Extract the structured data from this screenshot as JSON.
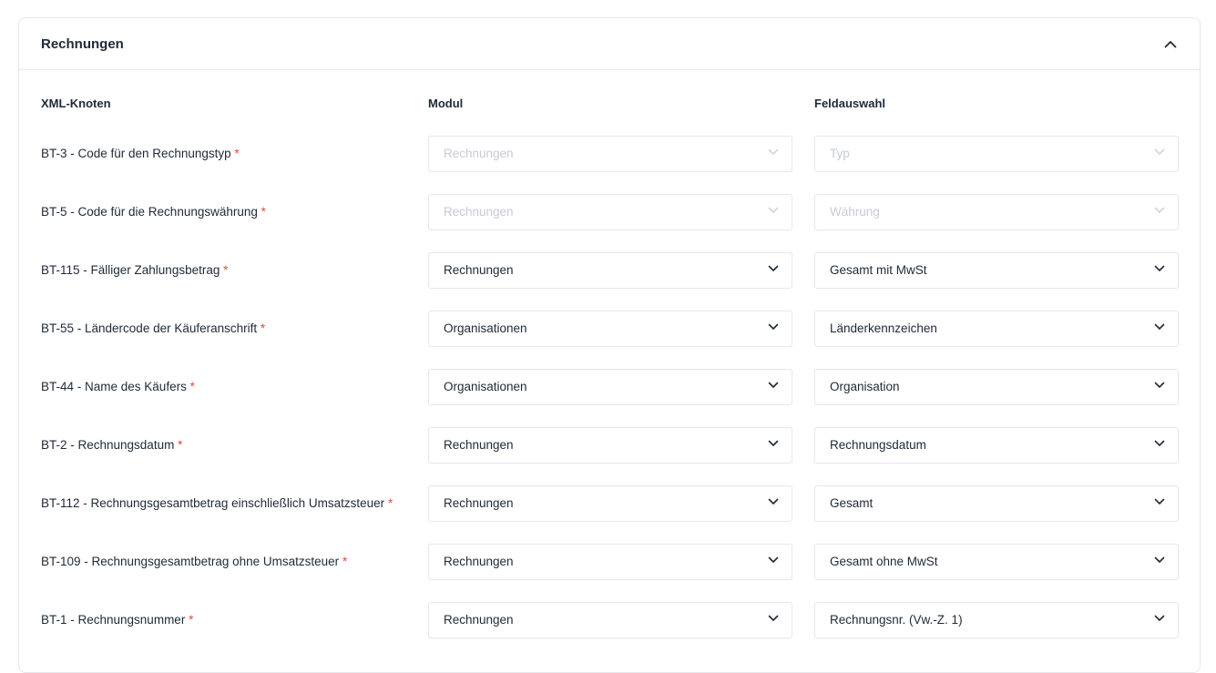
{
  "section": {
    "title": "Rechnungen"
  },
  "columns": {
    "xml": "XML-Knoten",
    "modul": "Modul",
    "feld": "Feldauswahl"
  },
  "required_marker": "*",
  "rows": [
    {
      "label": "BT-3 - Code für den Rechnungstyp",
      "modul": "Rechnungen",
      "feld": "Typ",
      "disabled": true
    },
    {
      "label": "BT-5 - Code für die Rechnungswährung",
      "modul": "Rechnungen",
      "feld": "Währung",
      "disabled": true
    },
    {
      "label": "BT-115 - Fälliger Zahlungsbetrag",
      "modul": "Rechnungen",
      "feld": "Gesamt mit MwSt",
      "disabled": false
    },
    {
      "label": "BT-55 - Ländercode der Käuferanschrift",
      "modul": "Organisationen",
      "feld": "Länderkennzeichen",
      "disabled": false
    },
    {
      "label": "BT-44 - Name des Käufers",
      "modul": "Organisationen",
      "feld": "Organisation",
      "disabled": false
    },
    {
      "label": "BT-2 - Rechnungsdatum",
      "modul": "Rechnungen",
      "feld": "Rechnungsdatum",
      "disabled": false
    },
    {
      "label": "BT-112 - Rechnungsgesamtbetrag einschließlich Umsatzsteuer",
      "modul": "Rechnungen",
      "feld": "Gesamt",
      "disabled": false
    },
    {
      "label": "BT-109 - Rechnungsgesamtbetrag ohne Umsatzsteuer",
      "modul": "Rechnungen",
      "feld": "Gesamt ohne MwSt",
      "disabled": false
    },
    {
      "label": "BT-1 - Rechnungsnummer",
      "modul": "Rechnungen",
      "feld": "Rechnungsnr. (Vw.-Z. 1)",
      "disabled": false
    }
  ],
  "icons": {
    "collapse": "chevron-up-icon",
    "dropdown": "chevron-down-icon"
  },
  "colors": {
    "required": "#e5483a",
    "border": "#e5e7eb",
    "disabled_text": "#c7cbd3"
  }
}
